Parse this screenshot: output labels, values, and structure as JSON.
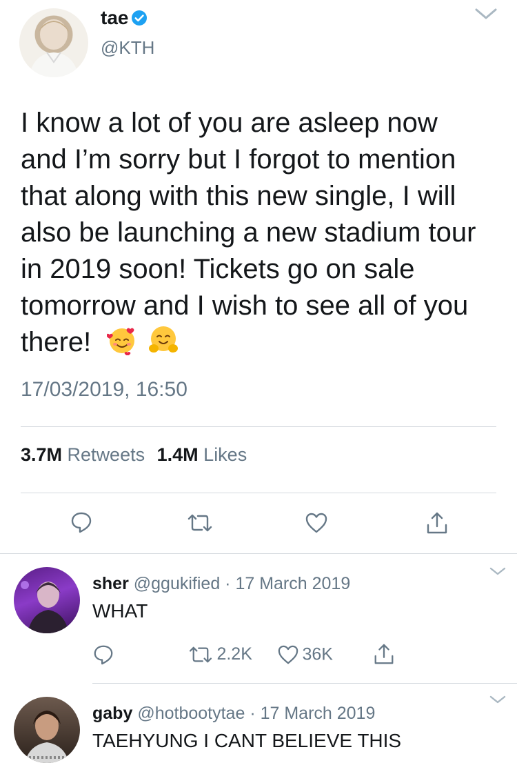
{
  "tweet": {
    "author_name": "tae",
    "handle": "@KTH",
    "verified_icon": "verified-badge-icon",
    "menu_icon": "chevron-down-icon",
    "text_lines": [
      "I know a lot of you are asleep now",
      "and I’m sorry but I forgot to mention",
      "that along with this new single, I will",
      "also be launching a new stadium tour",
      "in 2019 soon! Tickets go on sale",
      "tomorrow and I wish to see all of you",
      "there!"
    ],
    "emojis": [
      "smiling-face-with-hearts-icon",
      "hugging-face-icon"
    ],
    "timestamp": "17/03/2019, 16:50",
    "stats": {
      "retweets_count": "3.7M",
      "retweets_label": "Retweets",
      "likes_count": "1.4M",
      "likes_label": "Likes"
    },
    "actions": [
      "reply-icon",
      "retweet-icon",
      "like-icon",
      "share-icon"
    ],
    "colors": {
      "verified": "#1da1f2",
      "text": "#14171a",
      "muted": "#657786",
      "divider": "#d4d9de"
    }
  },
  "replies": [
    {
      "name": "sher",
      "handle": "@ggukified",
      "separator": "·",
      "date": "17 March 2019",
      "text": "WHAT",
      "retweets": "2.2K",
      "likes": "36K"
    },
    {
      "name": "gaby",
      "handle": "@hotbootytae",
      "separator": "·",
      "date": "17 March 2019",
      "text": "TAEHYUNG I CANT BELIEVE THIS"
    }
  ]
}
